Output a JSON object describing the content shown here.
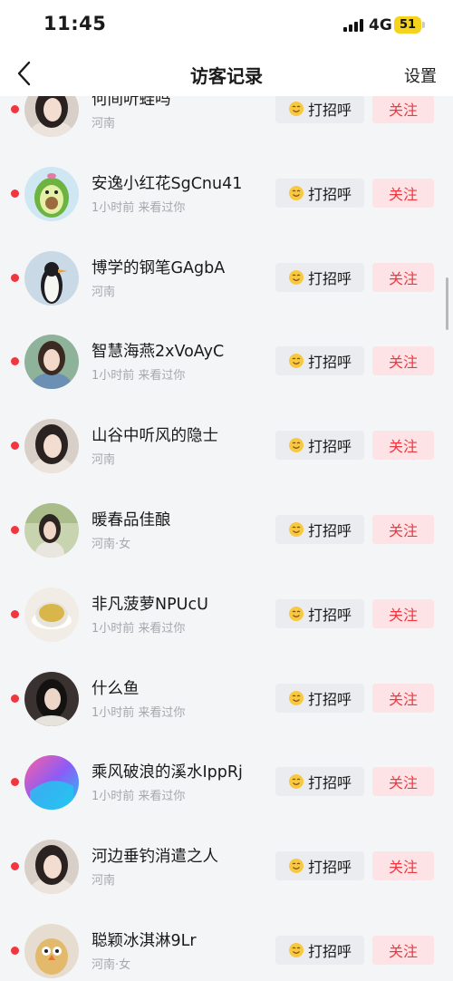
{
  "status_bar": {
    "time": "11:45",
    "network": "4G",
    "battery": "51"
  },
  "nav": {
    "title": "访客记录",
    "settings": "设置"
  },
  "buttons": {
    "greet": "打招呼",
    "follow": "关注"
  },
  "colors": {
    "accent_red": "#f0363f",
    "follow_bg": "#fde3e5",
    "greet_bg": "#ebecef",
    "list_bg": "#f4f5f7"
  },
  "visitors": [
    {
      "name": "何间听蛙吗",
      "sub": "河南",
      "avatar": "girl-portrait"
    },
    {
      "name": "安逸小红花SgCnu41",
      "sub": "1小时前 来看过你",
      "avatar": "avocado-cartoon"
    },
    {
      "name": "博学的钢笔GAgbA",
      "sub": "河南",
      "avatar": "penguin"
    },
    {
      "name": "智慧海燕2xVoAyC",
      "sub": "1小时前 来看过你",
      "avatar": "girl-outdoor"
    },
    {
      "name": "山谷中听风的隐士",
      "sub": "河南",
      "avatar": "girl-portrait"
    },
    {
      "name": "暖春品佳酿",
      "sub": "河南·女",
      "avatar": "girl-garden"
    },
    {
      "name": "非凡菠萝NPUcU",
      "sub": "1小时前 来看过你",
      "avatar": "tea-cup"
    },
    {
      "name": "什么鱼",
      "sub": "1小时前 来看过你",
      "avatar": "girl-dark"
    },
    {
      "name": "乘风破浪的溪水IppRj",
      "sub": "1小时前 来看过你",
      "avatar": "gradient-swirl"
    },
    {
      "name": "河边垂钓消遣之人",
      "sub": "河南",
      "avatar": "girl-portrait"
    },
    {
      "name": "聪颖冰淇淋9Lr",
      "sub": "河南·女",
      "avatar": "bird-cartoon"
    }
  ]
}
